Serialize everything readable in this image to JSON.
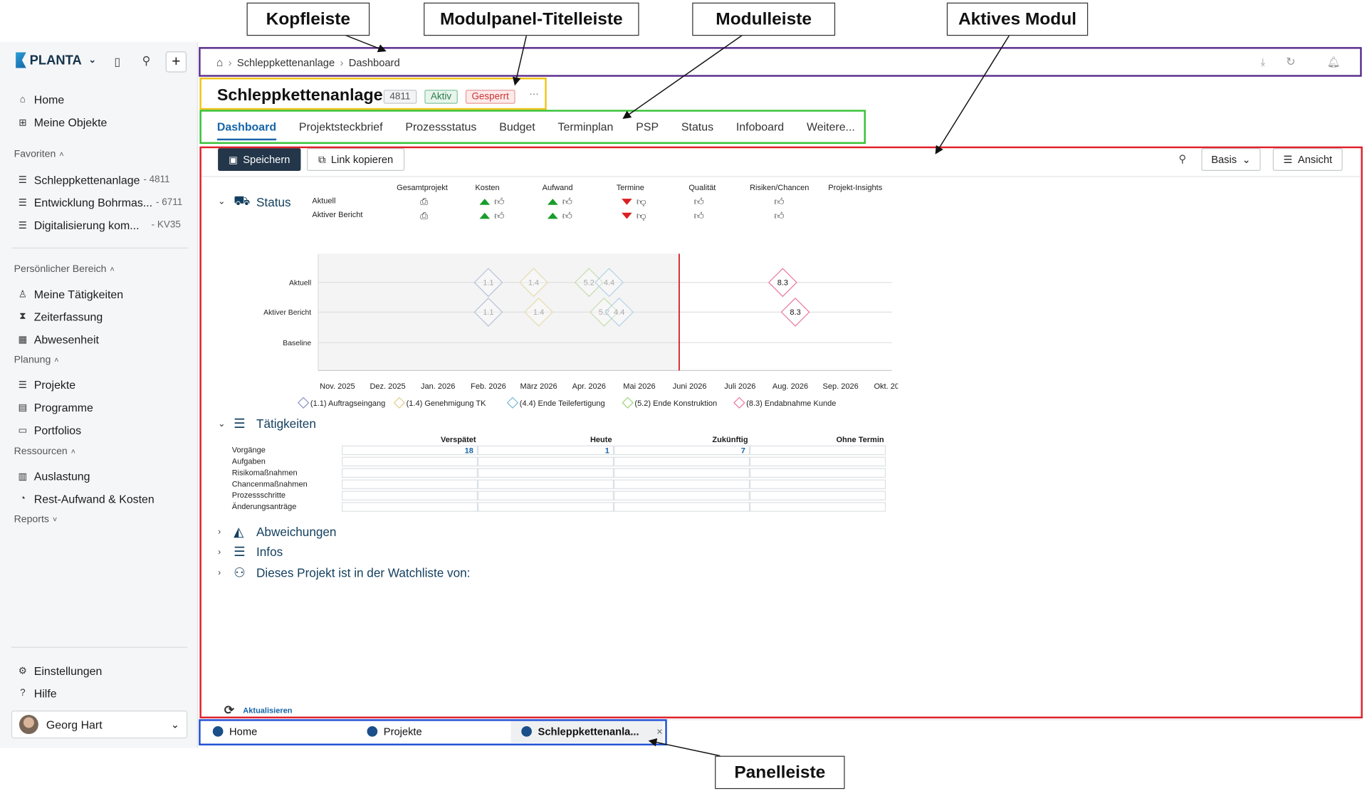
{
  "annotations": {
    "kopfleiste": "Kopfleiste",
    "modulpanel": "Modulpanel-Titelleiste",
    "modulleiste": "Modulleiste",
    "aktives_modul": "Aktives Modul",
    "panelleiste": "Panelleiste"
  },
  "colors": {
    "kopfleiste": "#5a2d8c",
    "modulpanel": "#f0c419",
    "modulleiste": "#36c236",
    "aktives_modul": "#e0202a",
    "panelleiste": "#1f4fd4"
  },
  "sidebar": {
    "brand": "PLANTA",
    "nav": [
      {
        "label": "Home",
        "icon": "home-icon"
      },
      {
        "label": "Meine Objekte",
        "icon": "grid-icon"
      }
    ],
    "favorites_title": "Favoriten",
    "favorites": [
      {
        "label": "Schleppkettenanlage",
        "sub": "- 4811"
      },
      {
        "label": "Entwicklung Bohrmas...",
        "sub": "- 6711"
      },
      {
        "label": "Digitalisierung kom...",
        "sub": "- KV35"
      }
    ],
    "personal_title": "Persönlicher Bereich",
    "personal": [
      {
        "label": "Meine Tätigkeiten"
      },
      {
        "label": "Zeiterfassung"
      },
      {
        "label": "Abwesenheit"
      }
    ],
    "planning_title": "Planung",
    "planning": [
      {
        "label": "Projekte"
      },
      {
        "label": "Programme"
      },
      {
        "label": "Portfolios"
      }
    ],
    "resources_title": "Ressourcen",
    "resources": [
      {
        "label": "Auslastung"
      },
      {
        "label": "Rest-Aufwand & Kosten"
      }
    ],
    "reports_title": "Reports",
    "bottom": [
      {
        "label": "Einstellungen"
      },
      {
        "label": "Hilfe"
      }
    ],
    "user": "Georg Hart"
  },
  "header": {
    "crumb1": "Schleppkettenanlage",
    "crumb2": "Dashboard"
  },
  "module": {
    "title": "Schleppkettenanlage",
    "id": "4811",
    "status": "Aktiv",
    "lock": "Gesperrt",
    "more": "···",
    "tabs": [
      "Dashboard",
      "Projektsteckbrief",
      "Prozessstatus",
      "Budget",
      "Terminplan",
      "PSP",
      "Status",
      "Infoboard",
      "Weitere..."
    ]
  },
  "toolbar": {
    "save": "Speichern",
    "copy": "Link kopieren",
    "view_select": "Basis",
    "view": "Ansicht"
  },
  "status": {
    "title": "Status",
    "columns": [
      "Gesamtprojekt",
      "Kosten",
      "Aufwand",
      "Termine",
      "Qualität",
      "Risiken/Chancen",
      "Projekt-Insights"
    ],
    "rows": [
      "Aktuell",
      "Aktiver Bericht"
    ]
  },
  "chart_data": {
    "type": "scatter",
    "rows": [
      "Aktuell",
      "Aktiver Bericht",
      "Baseline"
    ],
    "months": [
      "Nov. 2025",
      "Dez. 2025",
      "Jan. 2026",
      "Feb. 2026",
      "März 2026",
      "Apr. 2026",
      "Mai 2026",
      "Juni 2026",
      "Juli 2026",
      "Aug. 2026",
      "Sep. 2026",
      "Okt. 2026"
    ],
    "today": "Juni 2026",
    "points": [
      {
        "row": 0,
        "label": "1.1",
        "month": 3.0,
        "color": "#b9c2d8"
      },
      {
        "row": 0,
        "label": "1.4",
        "month": 3.9,
        "color": "#e6dcb0"
      },
      {
        "row": 0,
        "label": "5.2",
        "month": 5.0,
        "color": "#c8dcb0"
      },
      {
        "row": 0,
        "label": "4.4",
        "month": 5.4,
        "color": "#b4d4e4"
      },
      {
        "row": 0,
        "label": "8.3",
        "month": 8.85,
        "color": "#e87a9a"
      },
      {
        "row": 1,
        "label": "1.1",
        "month": 3.0,
        "color": "#b9c2d8"
      },
      {
        "row": 1,
        "label": "1.4",
        "month": 4.0,
        "color": "#e6dcb0"
      },
      {
        "row": 1,
        "label": "5.2",
        "month": 5.3,
        "color": "#c8dcb0"
      },
      {
        "row": 1,
        "label": "4.4",
        "month": 5.6,
        "color": "#b4d4e4"
      },
      {
        "row": 1,
        "label": "8.3",
        "month": 9.1,
        "color": "#e87a9a"
      }
    ],
    "legend": [
      {
        "label": "(1.1) Auftragseingang",
        "color": "#8a94c8"
      },
      {
        "label": "(1.4) Genehmigung TK",
        "color": "#e0cf8a"
      },
      {
        "label": "(4.4) Ende Teilefertigung",
        "color": "#7ab8d6"
      },
      {
        "label": "(5.2) Ende Konstruktion",
        "color": "#9cd47a"
      },
      {
        "label": "(8.3) Endabnahme Kunde",
        "color": "#e87a9a"
      }
    ]
  },
  "activities": {
    "title": "Tätigkeiten",
    "headers": [
      "Verspätet",
      "Heute",
      "Zukünftig",
      "Ohne Termin"
    ],
    "rows": [
      {
        "label": "Vorgänge",
        "values": [
          "18",
          "1",
          "7",
          ""
        ]
      },
      {
        "label": "Aufgaben",
        "values": [
          "",
          "",
          "",
          ""
        ]
      },
      {
        "label": "Risikomaßnahmen",
        "values": [
          "",
          "",
          "",
          ""
        ]
      },
      {
        "label": "Chancenmaßnahmen",
        "values": [
          "",
          "",
          "",
          ""
        ]
      },
      {
        "label": "Prozessschritte",
        "values": [
          "",
          "",
          "",
          ""
        ]
      },
      {
        "label": "Änderungsanträge",
        "values": [
          "",
          "",
          "",
          ""
        ]
      }
    ]
  },
  "sections": [
    "Abweichungen",
    "Infos",
    "Dieses Projekt ist in der Watchliste von:"
  ],
  "refresh": "Aktualisieren",
  "panelbar": [
    {
      "label": "Home"
    },
    {
      "label": "Projekte"
    },
    {
      "label": "Schleppkettenanla..."
    }
  ]
}
